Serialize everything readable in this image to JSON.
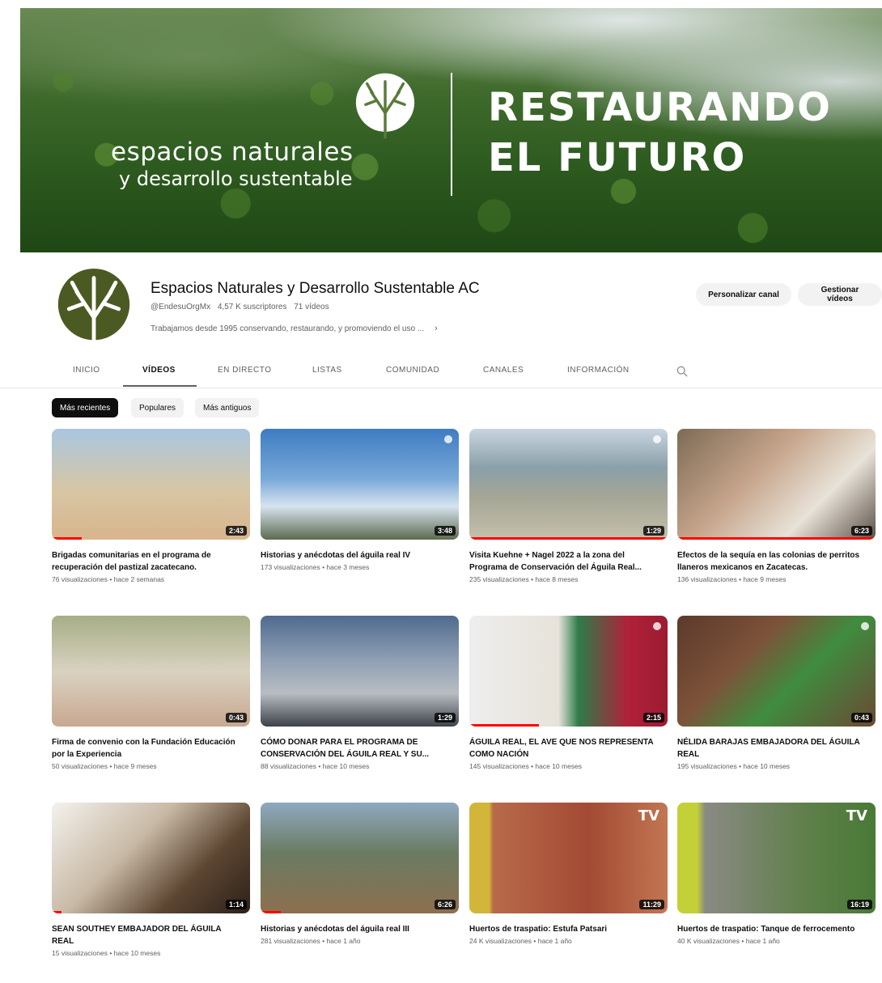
{
  "banner": {
    "brand_line1": "espacios naturales",
    "brand_line2": "y desarrollo sustentable",
    "headline_line1": "RESTAURANDO",
    "headline_line2": "EL FUTURO"
  },
  "channel": {
    "name": "Espacios Naturales y Desarrollo Sustentable AC",
    "handle": "@EndesuOrgMx",
    "subscribers": "4,57 K suscriptores",
    "video_count": "71 vídeos",
    "description": "Trabajamos desde 1995 conservando, restaurando, y promoviendo el uso ...",
    "desc_chevron": "›",
    "brand_color": "#4b5a22"
  },
  "actions": {
    "customize": "Personalizar canal",
    "manage": "Gestionar vídeos"
  },
  "tabs": [
    "INICIO",
    "VÍDEOS",
    "EN DIRECTO",
    "LISTAS",
    "COMUNIDAD",
    "CANALES",
    "INFORMACIÓN"
  ],
  "active_tab": "VÍDEOS",
  "chips": [
    "Más recientes",
    "Populares",
    "Más antiguos"
  ],
  "active_chip": "Más recientes",
  "videos": [
    {
      "title": "Brigadas comunitarias en el programa de recuperación del pastizal zacatecano.",
      "meta": "76 visualizaciones • hace 2 semanas",
      "duration": "2:43",
      "progress": 0.15
    },
    {
      "title": "Historias y anécdotas del águila real IV",
      "meta": "173 visualizaciones • hace 3 meses",
      "duration": "3:48",
      "progress": 0
    },
    {
      "title": "Visita Kuehne + Nagel 2022 a la zona del Programa de Conservación del Águila Real...",
      "meta": "235 visualizaciones • hace 8 meses",
      "duration": "1:29",
      "progress": 1
    },
    {
      "title": "Efectos de la sequía en las colonias de perritos llaneros mexicanos en Zacatecas.",
      "meta": "136 visualizaciones • hace 9 meses",
      "duration": "6:23",
      "progress": 1
    },
    {
      "title": "Firma de convenio con la Fundación Educación por la Experiencia",
      "meta": "50 visualizaciones • hace 9 meses",
      "duration": "0:43",
      "progress": 0
    },
    {
      "title": "CÓMO DONAR PARA EL PROGRAMA DE CONSERVACIÓN DEL ÁGUILA REAL Y SU...",
      "meta": "88 visualizaciones • hace 10 meses",
      "duration": "1:29",
      "progress": 0
    },
    {
      "title": "ÁGUILA REAL, EL AVE QUE NOS REPRESENTA COMO NACIÓN",
      "meta": "145 visualizaciones • hace 10 meses",
      "duration": "2:15",
      "progress": 0.35
    },
    {
      "title": "NÉLIDA BARAJAS EMBAJADORA DEL ÁGUILA REAL",
      "meta": "195 visualizaciones • hace 10 meses",
      "duration": "0:43",
      "progress": 0
    },
    {
      "title": "SEAN SOUTHEY EMBAJADOR DEL ÁGUILA REAL",
      "meta": "15 visualizaciones • hace 10 meses",
      "duration": "1:14",
      "progress": 0.05
    },
    {
      "title": "Historias y anécdotas del águila real III",
      "meta": "281 visualizaciones • hace 1 año",
      "duration": "6:26",
      "progress": 0.1
    },
    {
      "title": "Huertos de traspatio: Estufa Patsari",
      "meta": "24 K visualizaciones • hace 1 año",
      "duration": "11:29",
      "progress": 0
    },
    {
      "title": "Huertos de traspatio: Tanque de ferrocemento",
      "meta": "40 K visualizaciones • hace 1 año",
      "duration": "16:19",
      "progress": 0
    }
  ],
  "thumb_overlays": {
    "tv_logo": "TV"
  }
}
